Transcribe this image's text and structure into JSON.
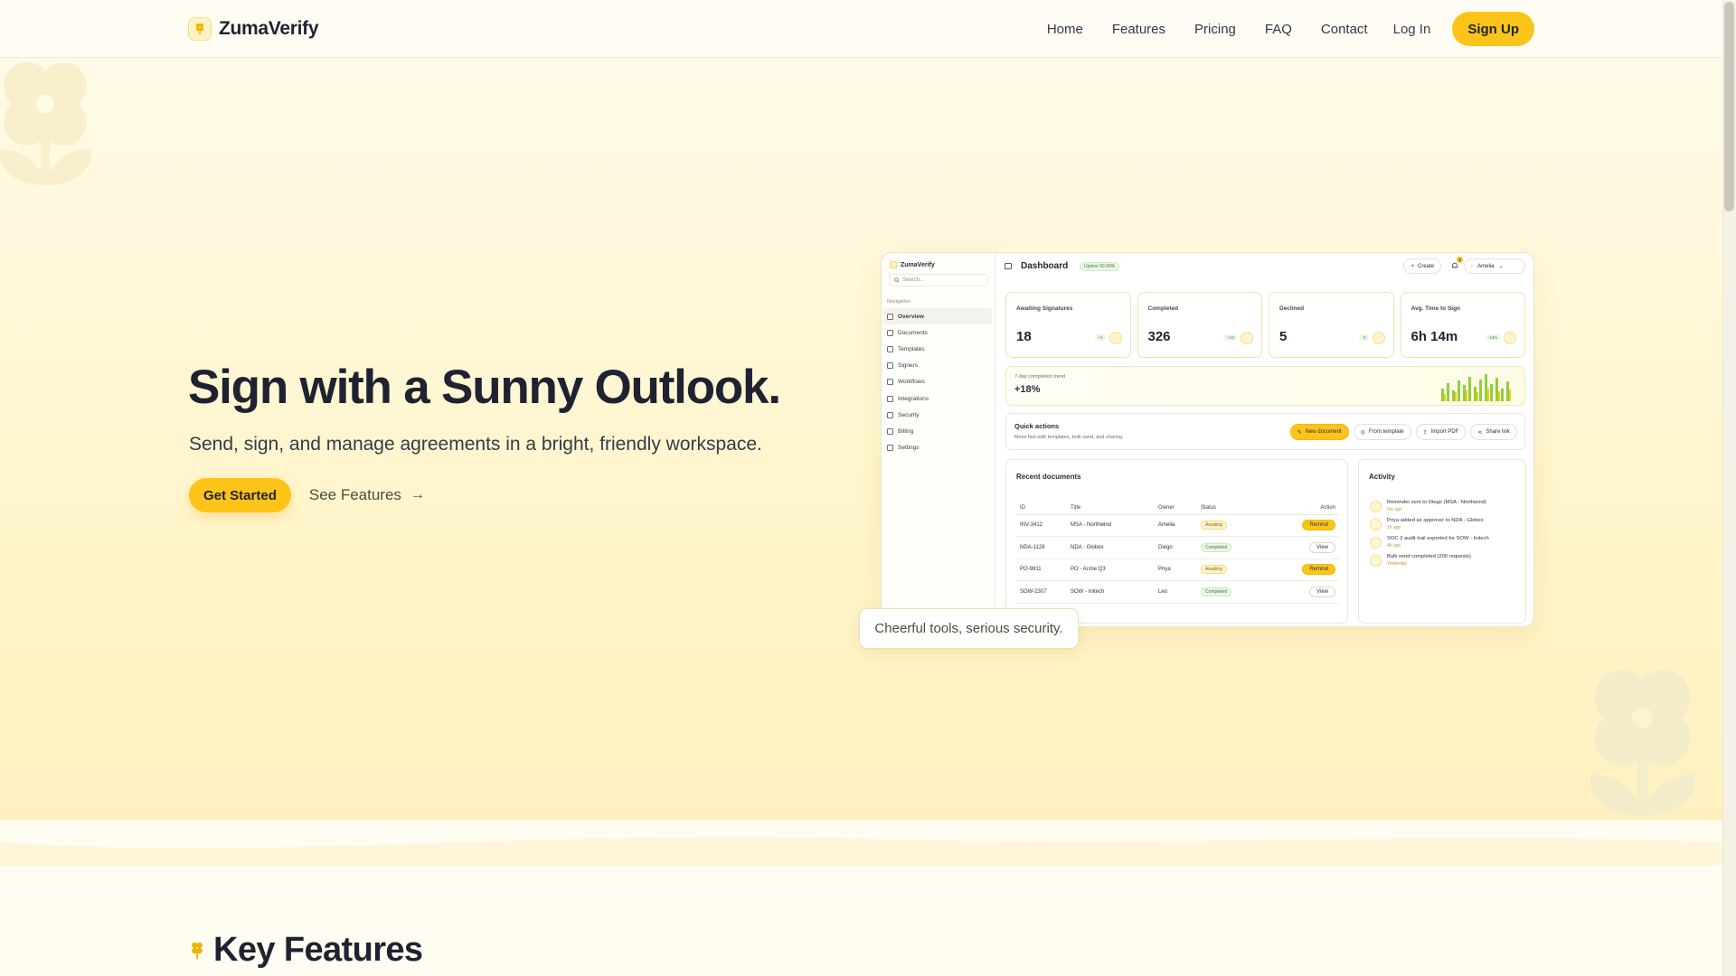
{
  "header": {
    "brand": "ZumaVerify",
    "nav": [
      "Home",
      "Features",
      "Pricing",
      "FAQ",
      "Contact"
    ],
    "login": "Log In",
    "signup": "Sign Up"
  },
  "hero": {
    "title": "Sign with a Sunny Outlook.",
    "subtitle": "Send, sign, and manage agreements in a bright, friendly workspace.",
    "cta_primary": "Get Started",
    "cta_secondary": "See Features",
    "tooltip": "Cheerful tools, serious security."
  },
  "dashboard": {
    "brand": "ZumaVerify",
    "search_placeholder": "Search...",
    "nav_label": "Navigation",
    "nav": [
      "Overview",
      "Documents",
      "Templates",
      "Signers",
      "Workflows",
      "Integrations",
      "Security",
      "Billing",
      "Settings"
    ],
    "title": "Dashboard",
    "uptime": "Uptime 99.99%",
    "create": "Create",
    "notifications": "3",
    "user": "Amelia",
    "kpis": [
      {
        "label": "Awaiting Signatures",
        "value": "18",
        "delta": "+4"
      },
      {
        "label": "Completed",
        "value": "326",
        "delta": "+12"
      },
      {
        "label": "Declined",
        "value": "5",
        "delta": "-2"
      },
      {
        "label": "Avg. Time to Sign",
        "value": "6h 14m",
        "delta": "-13m"
      }
    ],
    "trend": {
      "label": "7-day completion trend",
      "value": "+18%"
    },
    "quick_actions": {
      "title": "Quick actions",
      "subtitle": "Move fast with templates, bulk send, and sharing.",
      "buttons": [
        "New document",
        "From template",
        "Import PDF",
        "Share link"
      ]
    },
    "recent": {
      "title": "Recent documents",
      "columns": [
        "ID",
        "Title",
        "Owner",
        "Status",
        "Action"
      ],
      "rows": [
        {
          "id": "INV-3412",
          "title": "MSA - Northwind",
          "owner": "Amelia",
          "status": "Awaiting",
          "action": "Remind"
        },
        {
          "id": "NDA-1128",
          "title": "NDA - Globex",
          "owner": "Diego",
          "status": "Completed",
          "action": "View"
        },
        {
          "id": "PO-9811",
          "title": "PO - Acme Q3",
          "owner": "Priya",
          "status": "Awaiting",
          "action": "Remind"
        },
        {
          "id": "SOW-2307",
          "title": "SOW - Initech",
          "owner": "Leo",
          "status": "Completed",
          "action": "View"
        }
      ]
    },
    "activity": {
      "title": "Activity",
      "items": [
        {
          "text": "Reminder sent to Diego (MSA - Northwind)",
          "time": "2m ago"
        },
        {
          "text": "Priya added as approver to NDA - Globex",
          "time": "1h ago"
        },
        {
          "text": "SOC 2 audit trail exported for SOW - Initech",
          "time": "4h ago"
        },
        {
          "text": "Bulk send completed (200 requests)",
          "time": "Yesterday"
        }
      ]
    }
  },
  "features": {
    "title": "Key Features"
  },
  "colors": {
    "accent": "#fcc419",
    "background": "#fffbea",
    "text": "#1f2230"
  }
}
